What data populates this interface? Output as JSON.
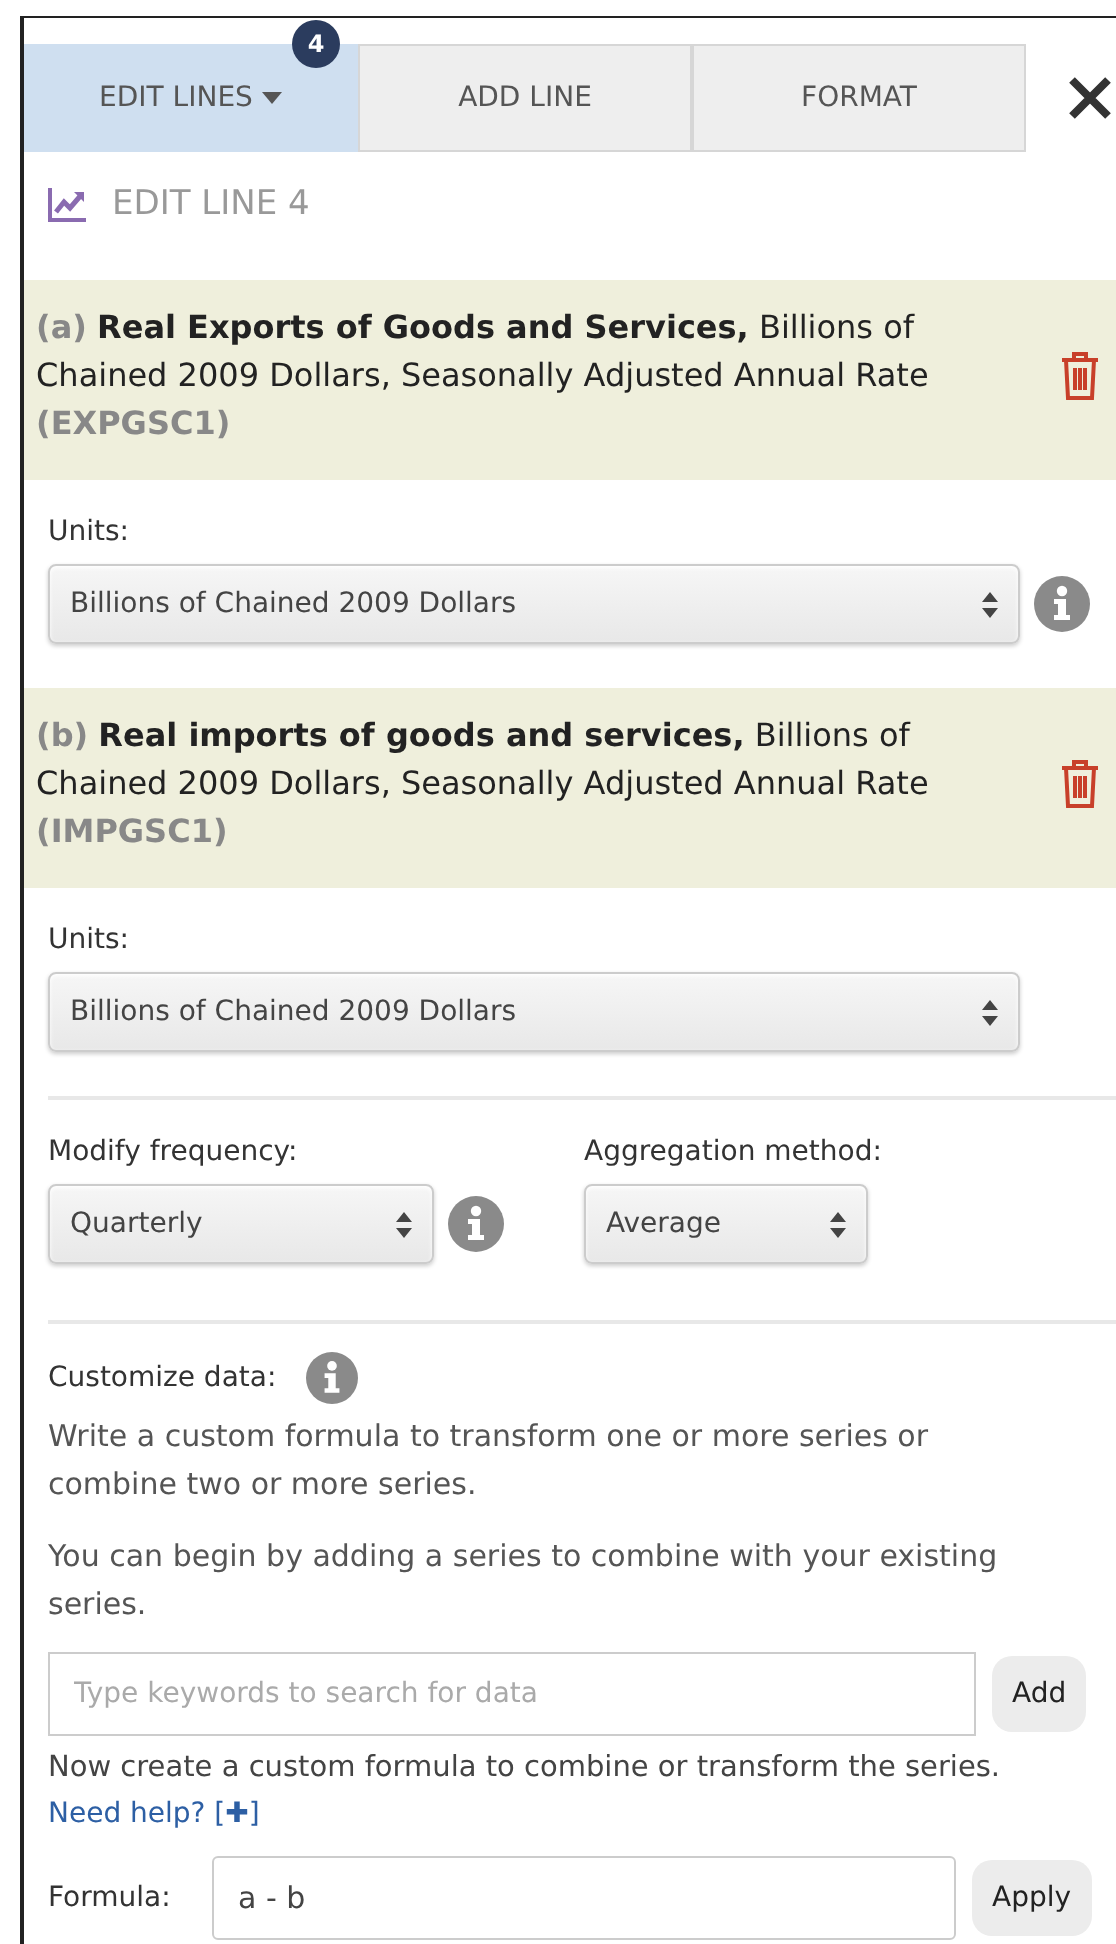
{
  "tabs": [
    {
      "label": "EDIT LINES",
      "selected": true,
      "badge": "4",
      "dropdown": true
    },
    {
      "label": "ADD LINE",
      "selected": false,
      "dropdown": false
    },
    {
      "label": "FORMAT",
      "selected": false,
      "dropdown": false
    }
  ],
  "heading": "EDIT LINE 4",
  "series": [
    {
      "prefix": "(a)",
      "title": "Real Exports of Goods and Services,",
      "description": "Billions of Chained 2009 Dollars, Seasonally Adjusted Annual Rate",
      "code": "(EXPGSC1)",
      "units_label": "Units:",
      "units_value": "Billions of Chained 2009 Dollars",
      "units_info": true
    },
    {
      "prefix": "(b)",
      "title": "Real imports of goods and services,",
      "description": "Billions of Chained 2009 Dollars, Seasonally Adjusted Annual Rate",
      "code": "(IMPGSC1)",
      "units_label": "Units:",
      "units_value": "Billions of Chained 2009 Dollars",
      "units_info": false
    }
  ],
  "frequency": {
    "label": "Modify frequency:",
    "value": "Quarterly"
  },
  "aggregation": {
    "label": "Aggregation method:",
    "value": "Average"
  },
  "customize": {
    "label": "Customize data:",
    "intro": "Write a custom formula to transform one or more series or combine two or more series.",
    "begin": "You can begin by adding a series to combine with your existing series.",
    "search_placeholder": "Type keywords to search for data",
    "add_button": "Add",
    "now": "Now create a custom formula to combine or transform the series.",
    "help_link": "Need help? [✚]",
    "formula_label": "Formula:",
    "formula_value": "a - b",
    "apply_button": "Apply"
  }
}
